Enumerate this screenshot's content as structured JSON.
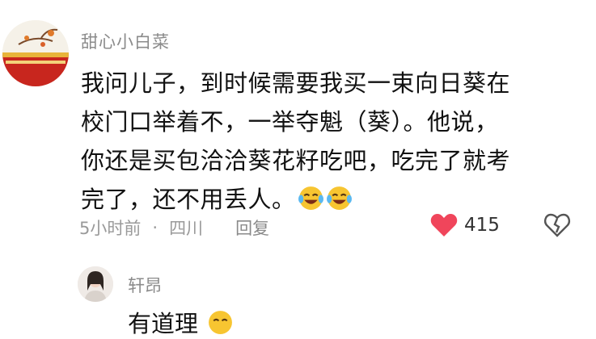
{
  "comment": {
    "username": "甜心小白菜",
    "lines": [
      "我问儿子，到时候需要我买一束向日葵在",
      "校门口举着不，一举夺魁（葵）。他说，",
      "你还是买包洽洽葵花籽吃吧，吃完了就考",
      "完了，还不用丢人。"
    ],
    "emojis": [
      "laughing-crying-icon",
      "laughing-crying-icon"
    ],
    "time": "5小时前",
    "separator": "·",
    "location": "四川",
    "reply_label": "回复",
    "like_count": "415",
    "like_color": "#f0455b"
  },
  "reply": {
    "username": "轩昂",
    "text": "有道理"
  }
}
